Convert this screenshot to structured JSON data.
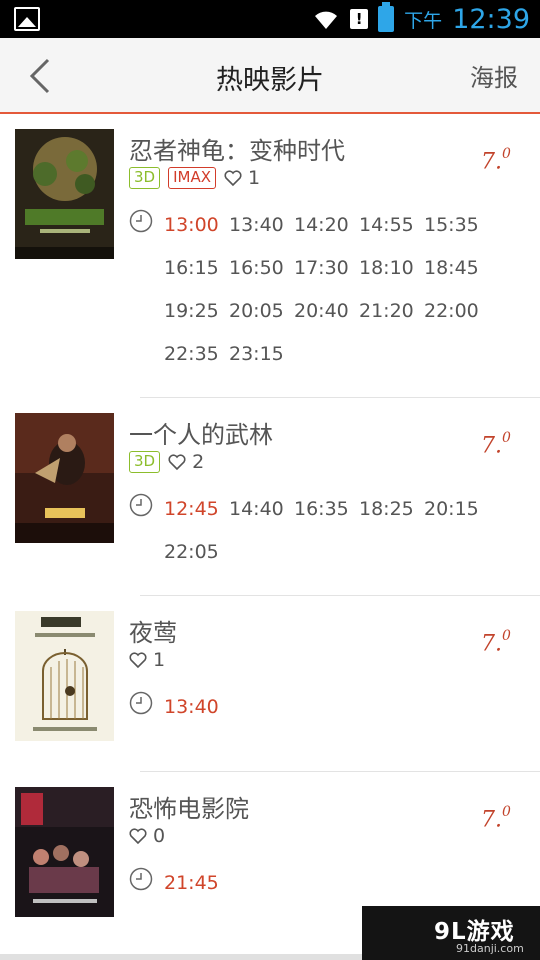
{
  "status_bar": {
    "ampm": "下午",
    "time": "12:39"
  },
  "header": {
    "back_icon": "chevron-left-icon",
    "title": "热映影片",
    "poster_link": "海报"
  },
  "movies": [
    {
      "title": "忍者神龟：变种时代",
      "tags": [
        "3D",
        "IMAX"
      ],
      "likes": "1",
      "score_main": "7.",
      "score_sup": "0",
      "times": [
        "13:00",
        "13:40",
        "14:20",
        "14:55",
        "15:35",
        "16:15",
        "16:50",
        "17:30",
        "18:10",
        "18:45",
        "19:25",
        "20:05",
        "20:40",
        "21:20",
        "22:00",
        "22:35",
        "23:15"
      ]
    },
    {
      "title": "一个人的武林",
      "tags": [
        "3D"
      ],
      "likes": "2",
      "score_main": "7.",
      "score_sup": "0",
      "times": [
        "12:45",
        "14:40",
        "16:35",
        "18:25",
        "20:15",
        "22:05"
      ]
    },
    {
      "title": "夜莺",
      "tags": [],
      "likes": "1",
      "score_main": "7.",
      "score_sup": "0",
      "times": [
        "13:40"
      ]
    },
    {
      "title": "恐怖电影院",
      "tags": [],
      "likes": "0",
      "score_main": "7.",
      "score_sup": "0",
      "times": [
        "21:45"
      ]
    }
  ],
  "watermark": {
    "logo": "9L游戏",
    "site": "91danji.com"
  },
  "colors": {
    "accent": "#e4593a",
    "first_time": "#d0452a",
    "tag_3d": "#8cbd2c",
    "tag_imax": "#d23c2a",
    "status_text": "#2ea6e8"
  }
}
